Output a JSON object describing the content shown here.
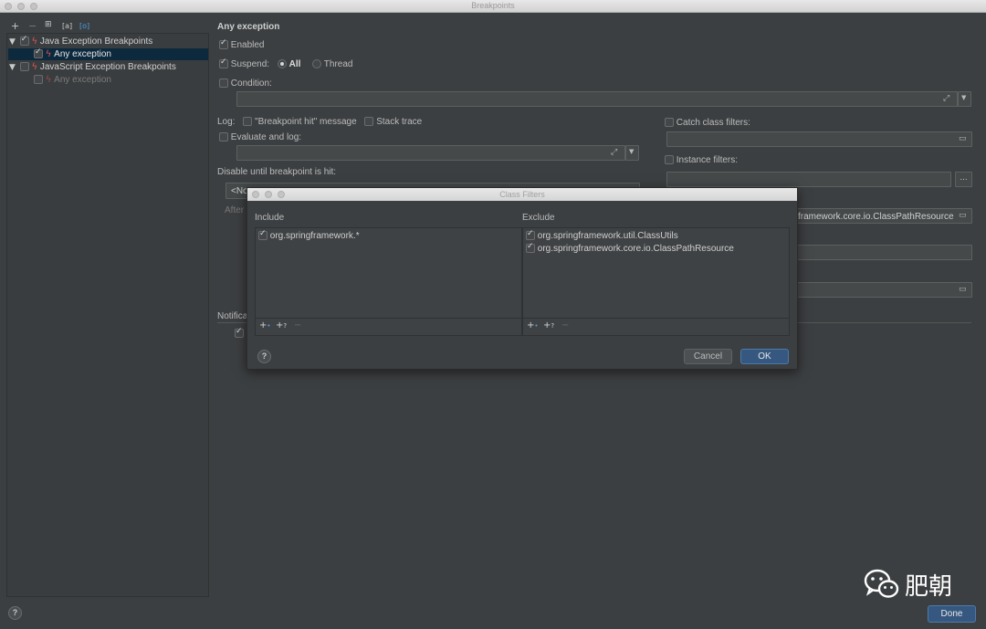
{
  "window": {
    "title": "Breakpoints"
  },
  "toolbar": {
    "add": "+",
    "remove": "−",
    "group1": "⊞",
    "group2": "[a]",
    "group3": "[o]"
  },
  "tree": {
    "groups": [
      {
        "label": "Java Exception Breakpoints",
        "checked": true,
        "child": "Any exception",
        "child_checked": true
      },
      {
        "label": "JavaScript Exception Breakpoints",
        "checked": false,
        "child": "Any exception",
        "child_checked": false
      }
    ]
  },
  "details": {
    "title": "Any exception",
    "enabled": "Enabled",
    "suspend": "Suspend:",
    "suspend_all": "All",
    "suspend_thread": "Thread",
    "condition": "Condition:",
    "log": "Log:",
    "log_message": "\"Breakpoint hit\" message",
    "stack_trace": "Stack trace",
    "evaluate": "Evaluate and log:",
    "disable_until": "Disable until breakpoint is hit:",
    "disable_value": "<No",
    "after": "After",
    "notifications": "Notifica",
    "catch_filters": "Catch class filters:",
    "instance_filters": "Instance filters:",
    "class_filter_value": "framework.core.io.ClassPathResource",
    "more": "..."
  },
  "dialog": {
    "title": "Class Filters",
    "include_header": "Include",
    "exclude_header": "Exclude",
    "include_items": [
      "org.springframework.*"
    ],
    "exclude_items": [
      "org.springframework.util.ClassUtils",
      "org.springframework.core.io.ClassPathResource"
    ],
    "help": "?",
    "cancel": "Cancel",
    "ok": "OK"
  },
  "footer": {
    "help": "?",
    "done": "Done"
  },
  "watermark": {
    "text": "肥朝"
  },
  "colors": {
    "accent": "#365880",
    "breakpoint": "#e05555",
    "selection": "#0d293e"
  }
}
